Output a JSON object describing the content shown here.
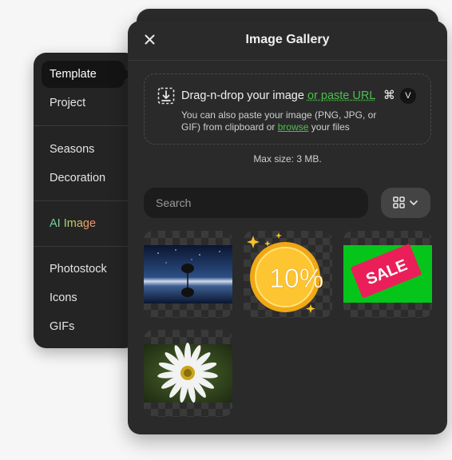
{
  "menu": {
    "items": [
      {
        "label": "Template",
        "active": true
      },
      {
        "label": "Project"
      },
      {
        "label": "Seasons"
      },
      {
        "label": "Decoration"
      },
      {
        "label": "AI Image"
      },
      {
        "label": "Photostock"
      },
      {
        "label": "Icons"
      },
      {
        "label": "GIFs"
      }
    ]
  },
  "gallery": {
    "title": "Image Gallery",
    "close_icon": "close-icon",
    "dropzone": {
      "main_text": "Drag-n-drop your image",
      "paste_link": "or paste URL",
      "shortcut_cmd": "⌘",
      "shortcut_key": "V",
      "sub_text_1": "You can also paste your image (PNG, JPG, or GIF) from clipboard or",
      "browse_link": "browse",
      "sub_text_2": "your files"
    },
    "max_size": "Max size: 3 MB.",
    "search": {
      "placeholder": "Search",
      "value": ""
    },
    "view_toggle_icon": "grid-icon",
    "thumbnails": [
      {
        "name": "night-sky-tree-reflection",
        "badge": ""
      },
      {
        "name": "gold-coin-discount",
        "badge": "10%"
      },
      {
        "name": "sale-tag",
        "badge": "SALE"
      },
      {
        "name": "white-daisy-flower",
        "badge": ""
      }
    ]
  },
  "colors": {
    "panel": "#2a2a2a",
    "link_green": "#4cc04c",
    "menu_bg": "#242424"
  }
}
